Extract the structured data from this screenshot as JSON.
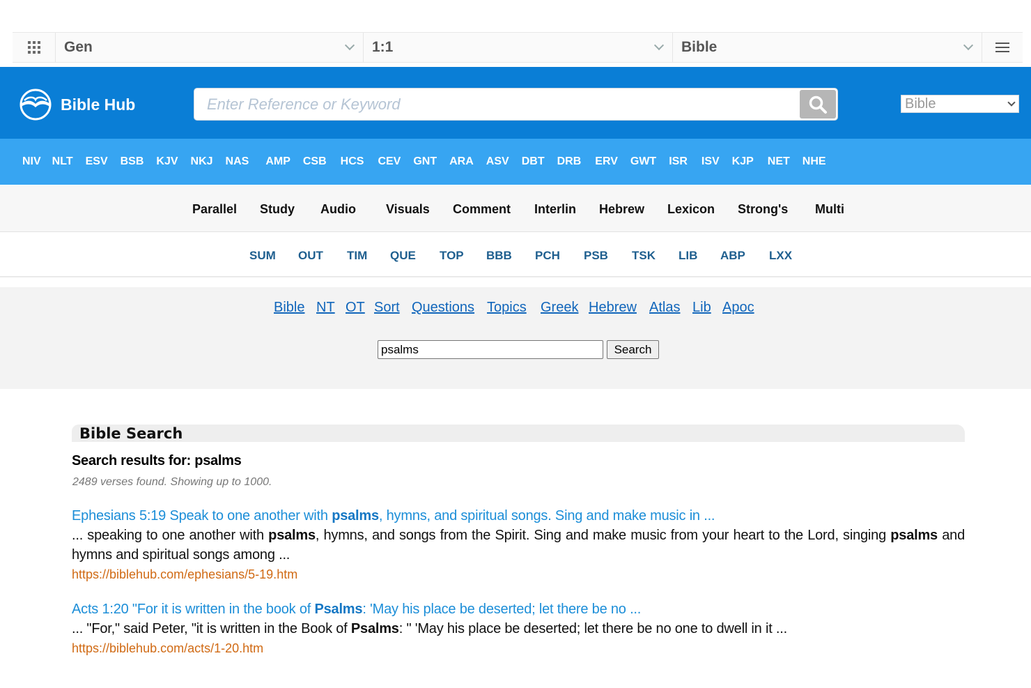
{
  "topbar": {
    "book": "Gen",
    "chapter_verse": "1:1",
    "version": "Bible"
  },
  "header": {
    "logo_text": "Bible Hub",
    "search_placeholder": "Enter Reference or Keyword",
    "version_select": "Bible"
  },
  "versions": [
    "NIV",
    "NLT",
    "ESV",
    "BSB",
    "KJV",
    "NKJ",
    "NAS",
    "AMP",
    "CSB",
    "HCS",
    "CEV",
    "GNT",
    "ARA",
    "ASV",
    "DBT",
    "DRB",
    "ERV",
    "GWT",
    "ISR",
    "ISV",
    "KJP",
    "NET",
    "NHE"
  ],
  "tools": [
    "Parallel",
    "Study",
    "Audio",
    "Visuals",
    "Comment",
    "Interlin",
    "Hebrew",
    "Lexicon",
    "Strong's",
    "Multi"
  ],
  "abbrs": [
    "SUM",
    "OUT",
    "TIM",
    "QUE",
    "TOP",
    "BBB",
    "PCH",
    "PSB",
    "TSK",
    "LIB",
    "ABP",
    "LXX"
  ],
  "nav_links": [
    "Bible",
    "NT",
    "OT",
    "Sort",
    "Questions",
    "Topics",
    "Greek",
    "Hebrew",
    "Atlas",
    "Lib",
    "Apoc"
  ],
  "search": {
    "query": "psalms",
    "button": "Search"
  },
  "results": {
    "heading": "Bible Search",
    "results_for_label": "Search results for: ",
    "results_for_term": "psalms",
    "found": "2489 verses found. Showing up to 1000.",
    "items": [
      {
        "title_parts": [
          "Ephesians 5:19 Speak to one another with ",
          "psalms",
          ", hymns, and spiritual songs. Sing and make music in ..."
        ],
        "text_parts": [
          "... speaking to one another with ",
          "psalms",
          ", hymns, and songs from the Spirit. Sing and make music from your heart to the Lord, singing ",
          "psalms",
          " and hymns and spiritual songs among ..."
        ],
        "url": "https://biblehub.com/ephesians/5-19.htm"
      },
      {
        "title_parts": [
          "Acts 1:20 \"For it is written in the book of ",
          "Psalms",
          ": 'May his place be deserted; let there be no ..."
        ],
        "text_parts": [
          "... \"For,\" said Peter, \"it is written in the Book of ",
          "Psalms",
          ": \" 'May his place be deserted; let there be no one to dwell in it ..."
        ],
        "url": "https://biblehub.com/acts/1-20.htm"
      }
    ]
  }
}
